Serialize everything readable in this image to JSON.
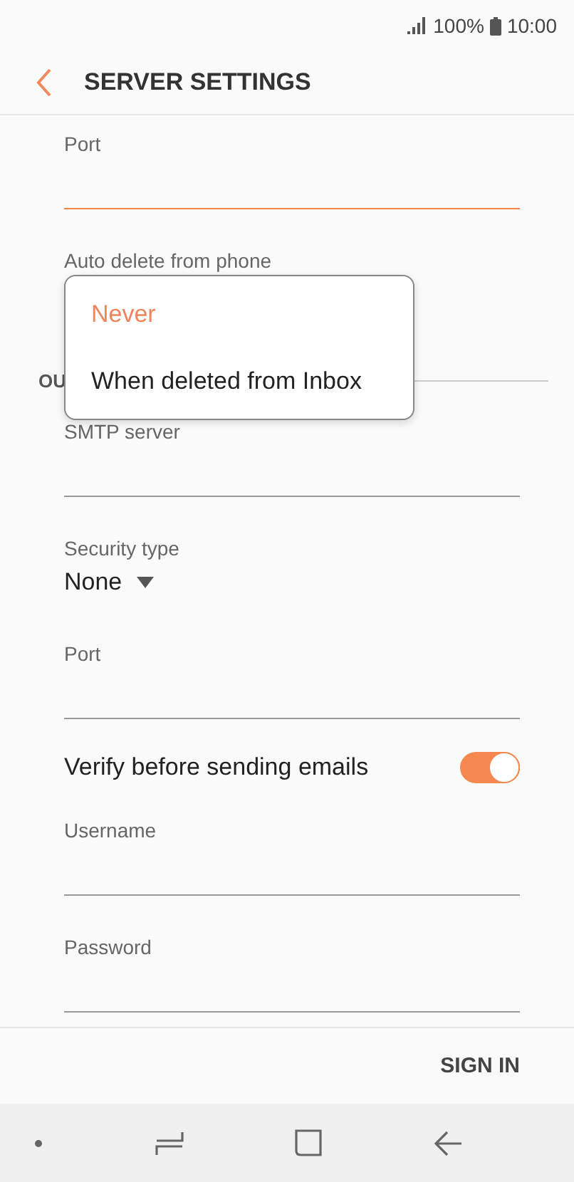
{
  "status_bar": {
    "battery": "100%",
    "time": "10:00"
  },
  "header": {
    "title": "SERVER SETTINGS"
  },
  "settings": [
    {
      "kind": "text",
      "label": "Port",
      "focused": true
    },
    {
      "kind": "select",
      "label": "Auto delete from phone"
    },
    {
      "kind": "section",
      "title": "OU"
    },
    {
      "kind": "text",
      "label": "SMTP server",
      "focused": false
    },
    {
      "kind": "dropdown",
      "label": "Security type",
      "value": "None"
    },
    {
      "kind": "text",
      "label": "Port",
      "focused": false
    },
    {
      "kind": "toggle",
      "label": "Verify before sending emails",
      "on": true
    },
    {
      "kind": "text",
      "label": "Username",
      "focused": false
    },
    {
      "kind": "text",
      "label": "Password",
      "focused": false
    }
  ],
  "popup": {
    "options": [
      {
        "label": "Never",
        "selected": true
      },
      {
        "label": "When deleted from Inbox",
        "selected": false
      }
    ]
  },
  "footer": {
    "button": "SIGN IN"
  }
}
